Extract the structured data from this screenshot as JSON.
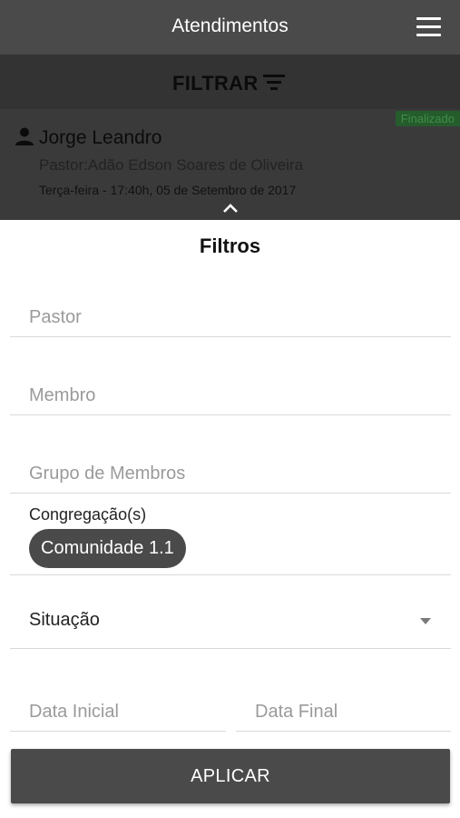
{
  "appbar": {
    "title": "Atendimentos",
    "menu_icon": "hamburger-icon"
  },
  "filter_bar": {
    "label": "FILTRAR",
    "icon": "filter-icon"
  },
  "list": {
    "items": [
      {
        "status": "Finalizado",
        "member_icon": "person-icon",
        "name": "Jorge Leandro",
        "pastor": "Pastor:Adão Edson Soares de Oliveira",
        "date": "Terça-feira - 17:40h, 05 de Setembro de 2017"
      }
    ],
    "collapse_icon": "chevron-up-icon"
  },
  "filters": {
    "title": "Filtros",
    "pastor_placeholder": "Pastor",
    "membro_placeholder": "Membro",
    "grupo_placeholder": "Grupo de Membros",
    "congregacao_label": "Congregação(s)",
    "congregacao_chips": [
      "Comunidade 1.1"
    ],
    "situacao_label": "Situação",
    "situacao_icon": "caret-down-icon",
    "data_inicial_placeholder": "Data Inicial",
    "data_final_placeholder": "Data Final",
    "apply_label": "APLICAR"
  },
  "colors": {
    "appbar": "#4a4a4a",
    "overlay": "#393939",
    "badge_bg": "#255c2c",
    "chip_bg": "#4a4a4a",
    "button_bg": "#4a4a4a"
  }
}
